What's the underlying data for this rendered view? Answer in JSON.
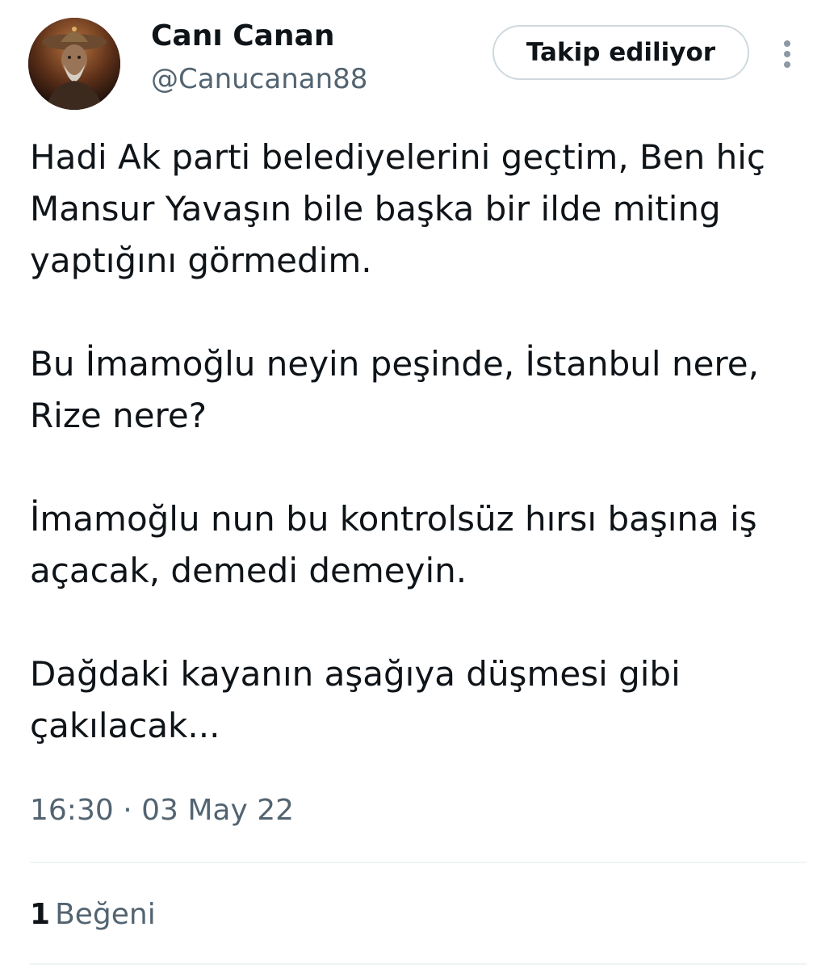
{
  "author": {
    "display_name": "Canı Canan",
    "handle": "@Canucanan88",
    "avatar_icon": "warrior-portrait-avatar"
  },
  "follow_button": {
    "label": "Takip ediliyor"
  },
  "more_icon": "more-vertical-icon",
  "tweet": {
    "paragraphs": [
      "Hadi Ak parti belediyelerini geçtim, Ben hiç Mansur Yavaşın bile başka bir ilde miting yaptığını görmedim.",
      "Bu İmamoğlu neyin peşinde, İstanbul nere, Rize nere?",
      "İmamoğlu nun bu kontrolsüz hırsı başına iş açacak, demedi demeyin.",
      "Dağdaki kayanın aşağıya düşmesi gibi çakılacak..."
    ],
    "timestamp": "16:30 · 03 May 22"
  },
  "stats": {
    "likes_count": "1",
    "likes_label": "Beğeni"
  },
  "colors": {
    "text": "#0f1419",
    "secondary": "#536471",
    "border": "#cfd9de",
    "divider": "#eff3f4"
  }
}
